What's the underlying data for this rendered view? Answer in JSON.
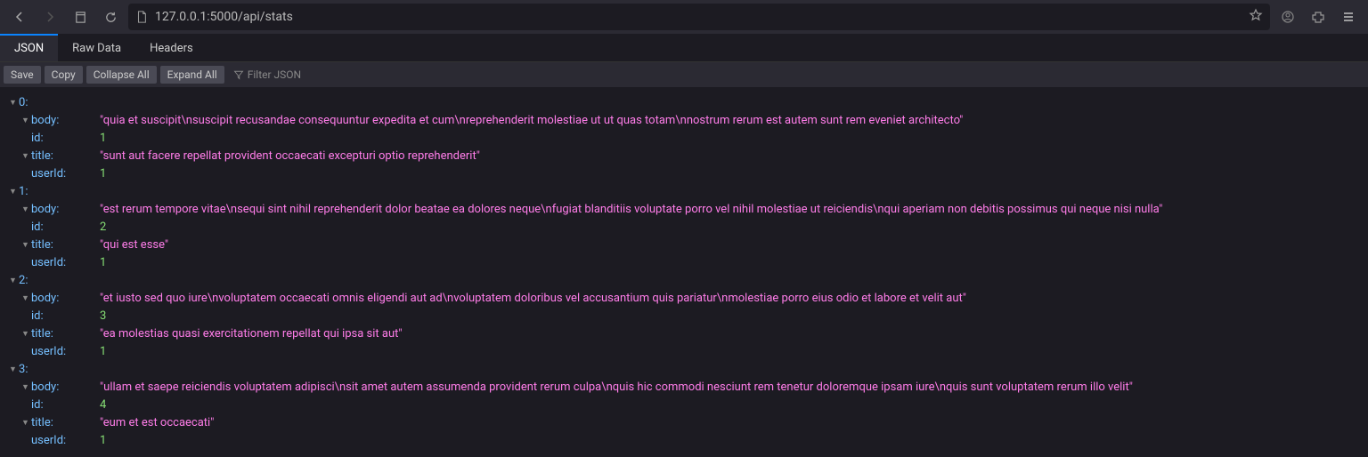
{
  "browser": {
    "url": "127.0.0.1:5000/api/stats"
  },
  "tabs": {
    "json": "JSON",
    "rawdata": "Raw Data",
    "headers": "Headers"
  },
  "tools": {
    "save": "Save",
    "copy": "Copy",
    "collapseAll": "Collapse All",
    "expandAll": "Expand All",
    "filterPlaceholder": "Filter JSON"
  },
  "keys": {
    "body": "body",
    "id": "id",
    "title": "title",
    "userId": "userId"
  },
  "items": [
    {
      "index": "0",
      "body": "\"quia et suscipit\\nsuscipit recusandae consequuntur expedita et cum\\nreprehenderit molestiae ut ut quas totam\\nnostrum rerum est autem sunt rem eveniet architecto\"",
      "id": "1",
      "title": "\"sunt aut facere repellat provident occaecati excepturi optio reprehenderit\"",
      "userId": "1"
    },
    {
      "index": "1",
      "body": "\"est rerum tempore vitae\\nsequi sint nihil reprehenderit dolor beatae ea dolores neque\\nfugiat blanditiis voluptate porro vel nihil molestiae ut reiciendis\\nqui aperiam non debitis possimus qui neque nisi nulla\"",
      "id": "2",
      "title": "\"qui est esse\"",
      "userId": "1"
    },
    {
      "index": "2",
      "body": "\"et iusto sed quo iure\\nvoluptatem occaecati omnis eligendi aut ad\\nvoluptatem doloribus vel accusantium quis pariatur\\nmolestiae porro eius odio et labore et velit aut\"",
      "id": "3",
      "title": "\"ea molestias quasi exercitationem repellat qui ipsa sit aut\"",
      "userId": "1"
    },
    {
      "index": "3",
      "body": "\"ullam et saepe reiciendis voluptatem adipisci\\nsit amet autem assumenda provident rerum culpa\\nquis hic commodi nesciunt rem tenetur doloremque ipsam iure\\nquis sunt voluptatem rerum illo velit\"",
      "id": "4",
      "title": "\"eum et est occaecati\"",
      "userId": "1"
    }
  ]
}
